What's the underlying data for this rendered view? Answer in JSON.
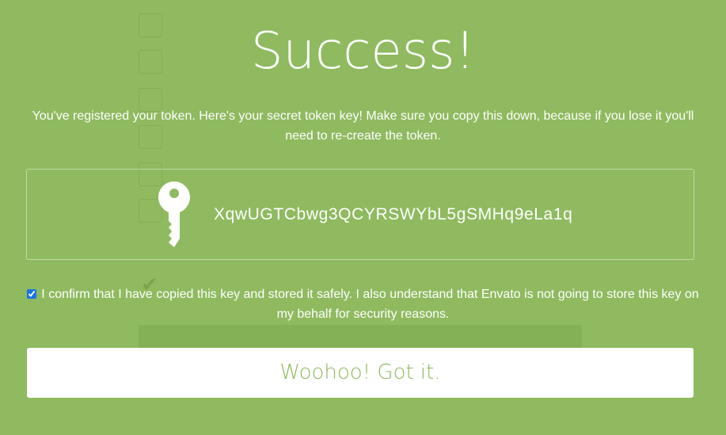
{
  "modal": {
    "title": "Success!",
    "message": "You've registered your token. Here's your secret token key! Make sure you copy this down, because if you lose it you'll need to re-create the token.",
    "token_key": "XqwUGTCbwg3QCYRSWYbL5gSMHq9eLa1q",
    "confirm_checked": true,
    "confirm_text": "I confirm that I have copied this key and stored it safely. I also understand that Envato is not going to store this key on my behalf for security reasons.",
    "button_label": "Woohoo! Got it."
  },
  "icons": {
    "key": "key-icon"
  },
  "colors": {
    "overlay_green": "#8fba5f",
    "text": "#ffffff",
    "button_bg": "#ffffff",
    "button_text": "#8fba5f"
  }
}
